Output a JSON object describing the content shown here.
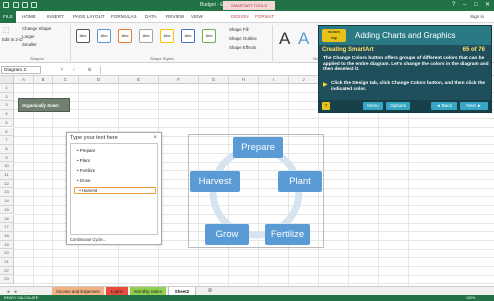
{
  "window": {
    "title": "Budget - Excel",
    "contextual_tab_header": "SMARTART TOOLS",
    "controls": [
      "?",
      "–",
      "□",
      "✕"
    ],
    "sign_in": "Sign in"
  },
  "tabs": [
    "FILE",
    "HOME",
    "INSERT",
    "PAGE LAYOUT",
    "FORMULAS",
    "DATA",
    "REVIEW",
    "VIEW",
    "DESIGN",
    "FORMAT"
  ],
  "ribbon": {
    "change_shape": "Change Shape",
    "larger": "Larger",
    "smaller": "Smaller",
    "edit_in_2d": "Edit in 2-D",
    "shapes_group": "Shapes",
    "shape_swatch_label": "Abc",
    "shape_styles_group": "Shape Styles",
    "shape_fill": "Shape Fill",
    "shape_outline": "Shape Outline",
    "shape_effects": "Shape Effects",
    "wordart_glyph": "A",
    "wordart_group": "Wo"
  },
  "formula_bar": {
    "name_box": "Diagram 2",
    "fx": "fx"
  },
  "columns": [
    "A",
    "B",
    "C",
    "D",
    "E",
    "F",
    "G",
    "H",
    "I",
    "J",
    "K",
    "L",
    "M"
  ],
  "rows": [
    "1",
    "2",
    "3",
    "4",
    "5",
    "6",
    "7",
    "8",
    "9",
    "10",
    "11",
    "12",
    "13",
    "14",
    "15",
    "16",
    "17",
    "18",
    "19",
    "20",
    "21",
    "22",
    "23"
  ],
  "logo_text": "Organically Sown",
  "tutorial": {
    "title": "Adding Charts and Graphics",
    "subtitle": "Creating SmartArt",
    "count": "65 of 76",
    "body": "The Change Colors button offers groups of different colors that can be applied to the entire diagram. Let's change the colors in the diagram and then deselect it.",
    "instruction": "Click the Design tab, click Change Colors button, and then click the indicated color.",
    "buttons": {
      "help": "?",
      "menu": "Menu",
      "options": "Options",
      "back": "◄ Back",
      "next": "Next ►"
    }
  },
  "text_pane": {
    "title": "Type your text here",
    "close": "×",
    "items": [
      "Prepare",
      "Plant",
      "Fertilize",
      "Grow",
      "Harvest"
    ],
    "footer": "Continuous Cycle..."
  },
  "smartart": {
    "nodes": [
      "Prepare",
      "Plant",
      "Fertilize",
      "Grow",
      "Harvest"
    ],
    "colors": {
      "node": "#5b9bd5",
      "cycle": "#d6e4f1"
    }
  },
  "sheet_tabs": [
    {
      "label": "Income and Expenses",
      "color": "#f4b183"
    },
    {
      "label": "Loans",
      "color": "#e84a3d"
    },
    {
      "label": "Monthly Sales",
      "color": "#8fd14f"
    },
    {
      "label": "Sheet2",
      "color": "#ffffff"
    }
  ],
  "status": {
    "left": "READY   CALCULATE",
    "zoom": "100%"
  }
}
